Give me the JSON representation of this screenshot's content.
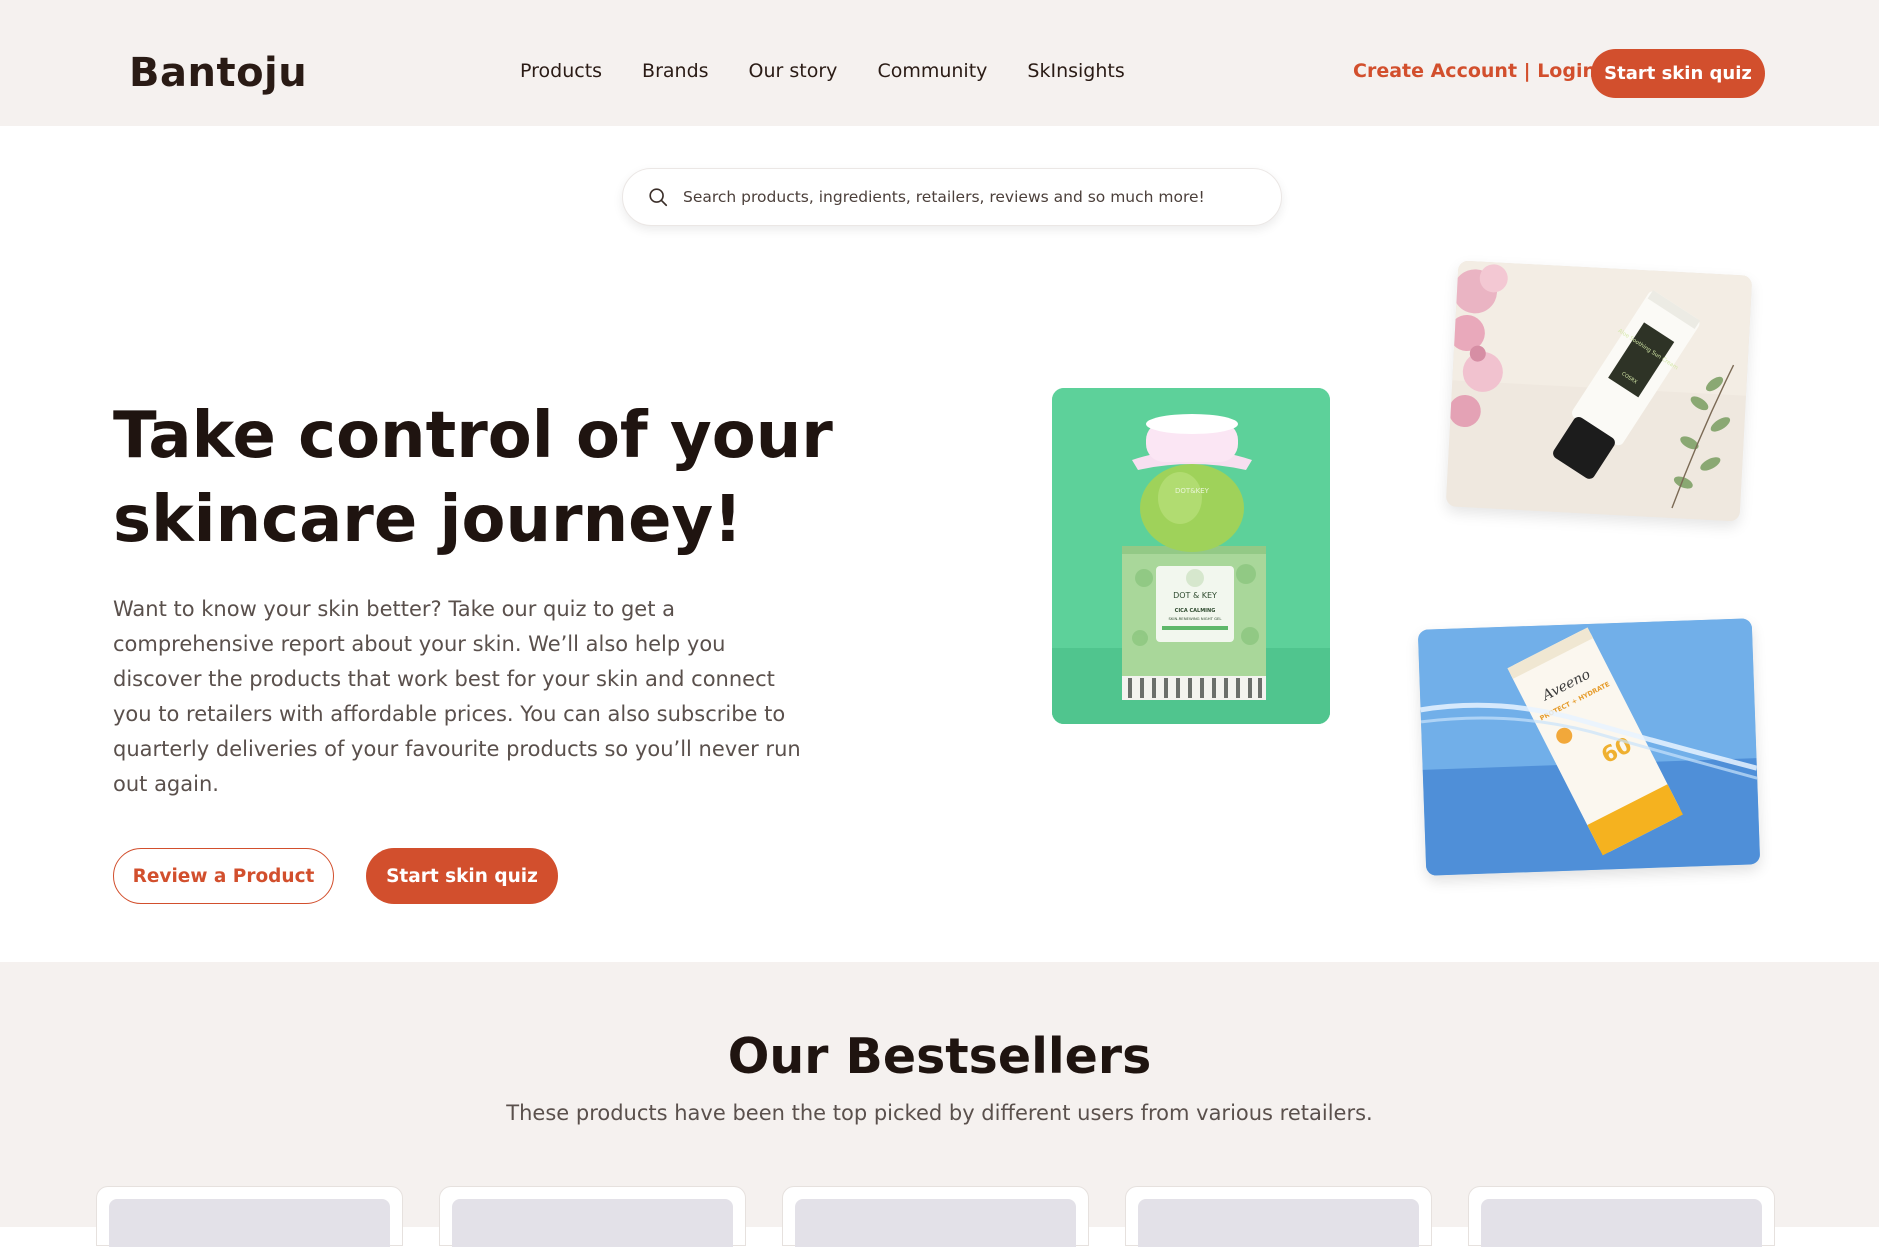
{
  "header": {
    "logo": "Bantoju",
    "nav": [
      "Products",
      "Brands",
      "Our story",
      "Community",
      "SkInsights"
    ],
    "auth_link": "Create Account | Login",
    "cta": "Start skin quiz"
  },
  "search": {
    "placeholder": "Search products, ingredients, retailers, reviews and so much more!"
  },
  "hero": {
    "title": "Take control of your skincare journey!",
    "description": "Want to know your skin better? Take our quiz to get a comprehensive report about your skin. We’ll also help you discover the products that work best for your skin and connect you to retailers with affordable prices. You can also subscribe to quarterly deliveries of your favourite products so you’ll never run out again.",
    "secondary_button": "Review a Product",
    "primary_button": "Start skin quiz",
    "images": {
      "green": {
        "brand": "DOT & KEY",
        "product": "CICA CALMING",
        "subtitle": "SKIN-RENEWING NIGHT GEL"
      },
      "cream": {
        "product": "Aloe Soothing Sun Cream",
        "brand": "COSRX"
      },
      "blue": {
        "brand": "Aveeno",
        "product": "PROTECT + HYDRATE",
        "spf": "60"
      }
    }
  },
  "bestsellers": {
    "title": "Our Bestsellers",
    "subtitle": "These products have been the top picked by different users from various retailers.",
    "card_count": 5
  },
  "colors": {
    "accent": "#d24f2d",
    "header_bg": "#f5f1ef",
    "text_dark": "#1f1410",
    "text_muted": "#5a504c"
  }
}
